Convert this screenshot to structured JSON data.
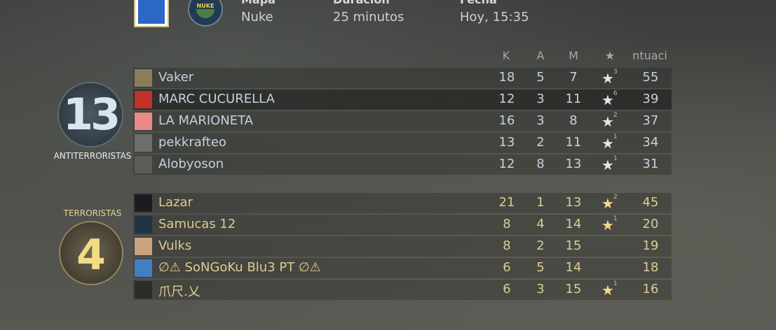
{
  "match": {
    "map_label": "Mapa",
    "map_value": "Nuke",
    "duration_label": "Duración",
    "duration_value": "25 minutos",
    "date_label": "Fecha",
    "date_value": "Hoy, 15:35"
  },
  "columns": {
    "kills": "K",
    "assists": "A",
    "deaths": "M",
    "mvp": "★",
    "score": "ntuaci"
  },
  "teams": {
    "ct": {
      "name": "ANTITERRORISTAS",
      "score": "13"
    },
    "t": {
      "name": "TERRORISTAS",
      "score": "4"
    }
  },
  "ct_players": [
    {
      "name": "Vaker",
      "k": "18",
      "a": "5",
      "m": "7",
      "mvp_star": "★",
      "mvp_count": "3",
      "score": "55"
    },
    {
      "name": "MARC CUCURELLA",
      "k": "12",
      "a": "3",
      "m": "11",
      "mvp_star": "★",
      "mvp_count": "6",
      "score": "39"
    },
    {
      "name": "LA MARIONETA",
      "k": "16",
      "a": "3",
      "m": "8",
      "mvp_star": "★",
      "mvp_count": "2",
      "score": "37"
    },
    {
      "name": "pekkrafteo",
      "k": "13",
      "a": "2",
      "m": "11",
      "mvp_star": "★",
      "mvp_count": "1",
      "score": "34"
    },
    {
      "name": "Alobyoson",
      "k": "12",
      "a": "8",
      "m": "13",
      "mvp_star": "★",
      "mvp_count": "1",
      "score": "31"
    }
  ],
  "t_players": [
    {
      "name": "Lazar",
      "k": "21",
      "a": "1",
      "m": "13",
      "mvp_star": "★",
      "mvp_count": "2",
      "score": "45"
    },
    {
      "name": "Samucas 12",
      "k": "8",
      "a": "4",
      "m": "14",
      "mvp_star": "★",
      "mvp_count": "1",
      "score": "20"
    },
    {
      "name": "Vulks",
      "k": "8",
      "a": "2",
      "m": "15",
      "mvp_star": "",
      "mvp_count": "",
      "score": "19"
    },
    {
      "name": "∅⚠ SoNGoKu Blu3 PT ∅⚠",
      "k": "6",
      "a": "5",
      "m": "14",
      "mvp_star": "",
      "mvp_count": "",
      "score": "18"
    },
    {
      "name": "爪尺.乂",
      "k": "6",
      "a": "3",
      "m": "15",
      "mvp_star": "★",
      "mvp_count": "1",
      "score": "16"
    }
  ],
  "avatar_colors": {
    "ct": [
      "#8a7d5c",
      "#c4312b",
      "#e98a86",
      "#6d6e6a",
      "#5b5b58"
    ],
    "t": [
      "#1a1c22",
      "#203445",
      "#c9a27e",
      "#3f7fc2",
      "#2b2b2b"
    ]
  }
}
